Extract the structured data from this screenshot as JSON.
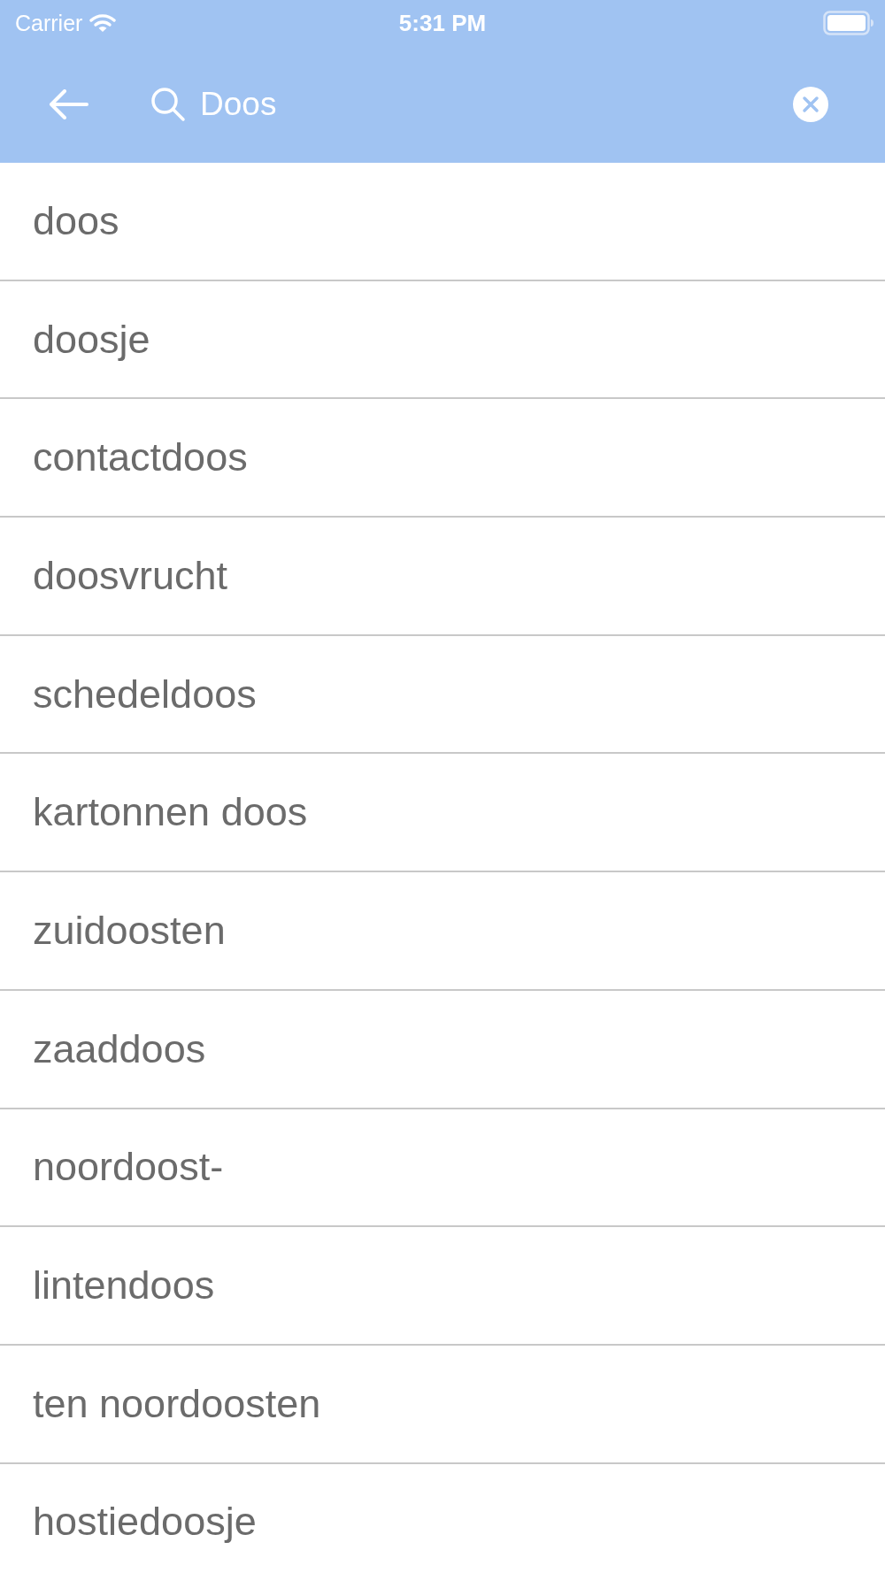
{
  "status_bar": {
    "carrier": "Carrier",
    "time": "5:31 PM"
  },
  "search": {
    "value": "Doos"
  },
  "results": [
    "doos",
    "doosje",
    "contactdoos",
    "doosvrucht",
    "schedeldoos",
    "kartonnen doos",
    "zuidoosten",
    "zaaddoos",
    "noordoost-",
    "lintendoos",
    "ten noordoosten",
    "hostiedoosje"
  ]
}
